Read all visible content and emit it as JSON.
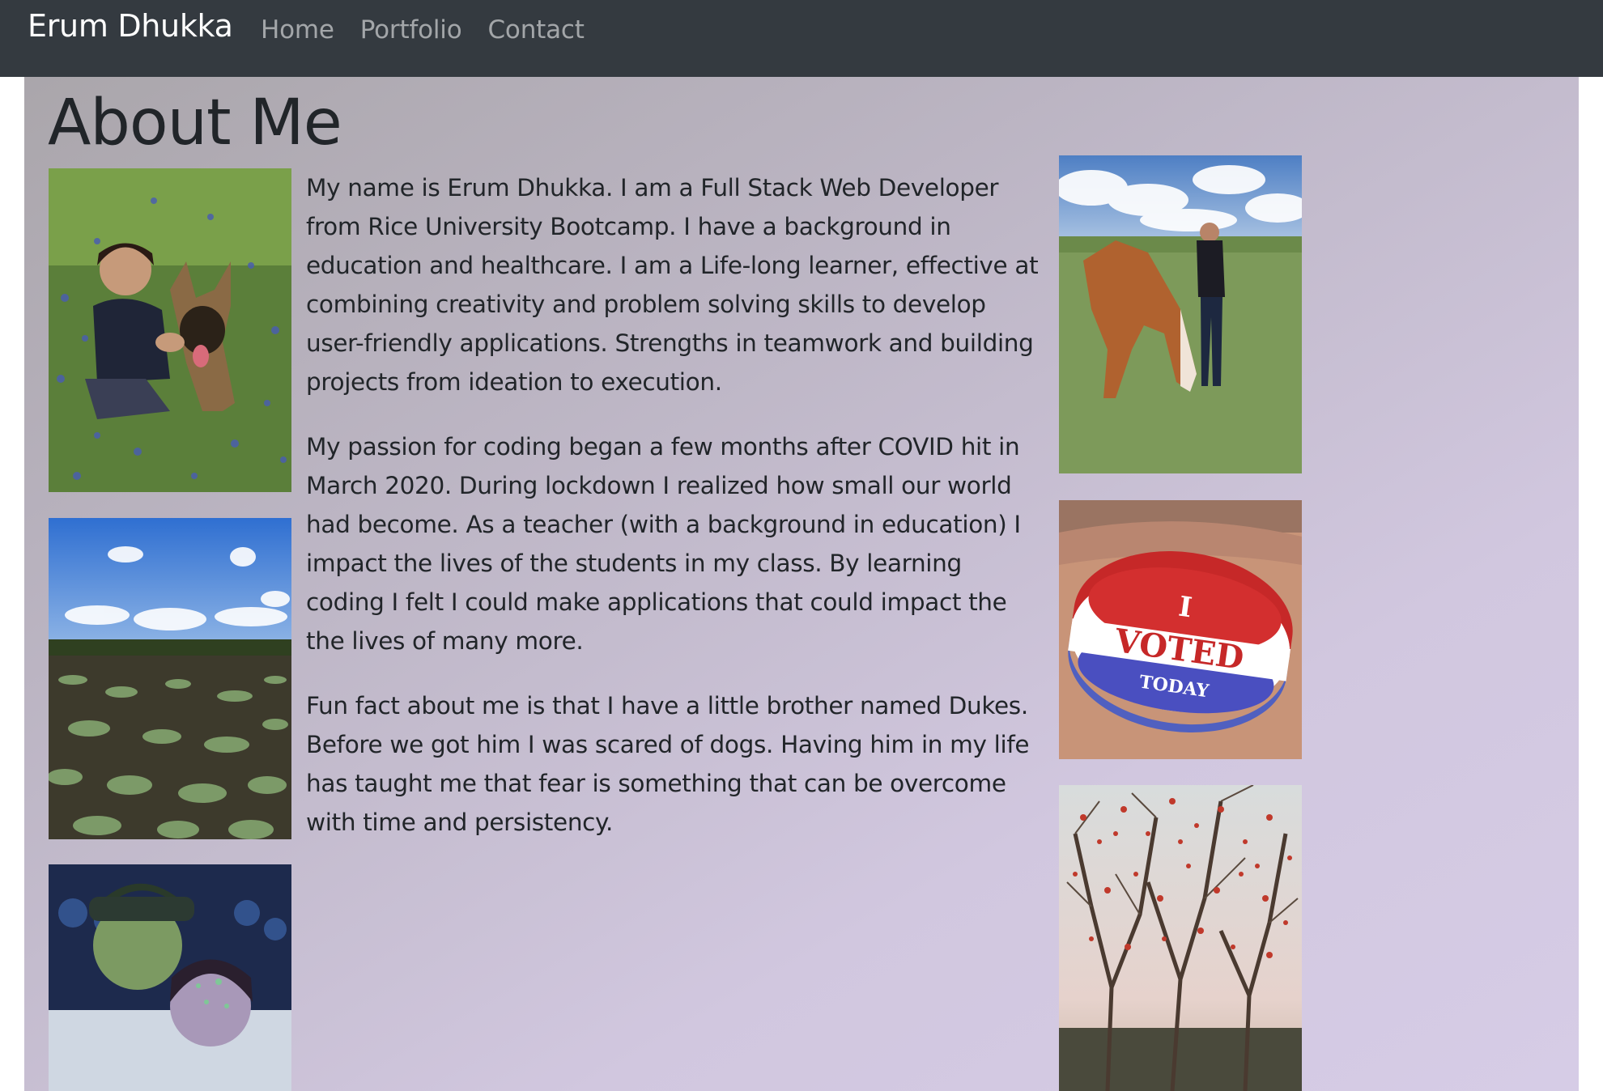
{
  "navbar": {
    "brand": "Erum Dhukka",
    "links": [
      "Home",
      "Portfolio",
      "Contact"
    ]
  },
  "main": {
    "title": "About Me",
    "paragraphs": [
      "My name is Erum Dhukka. I am a Full Stack Web Developer from Rice University Bootcamp. I have a background in education and healthcare. I am a Life-long learner, effective at combining creativity and problem solving skills to develop user-friendly applications. Strengths in teamwork and building projects from ideation to execution.",
      "My passion for coding began a few months after COVID hit in March 2020. During lockdown I realized how small our world had become. As a teacher (with a background in education) I impact the lives of the students in my class. By learning coding I felt I could make applications that could impact the the lives of many more.",
      "Fun fact about me is that I have a little brother named Dukes. Before we got him I was scared of dogs. Having him in my life has taught me that fear is something that can be overcome with time and persistency."
    ],
    "sticker_text": {
      "line1": "I",
      "line2": "VOTED",
      "line3": "TODAY"
    }
  },
  "colors": {
    "navbar_bg": "#343a40",
    "nav_link": "rgba(255,255,255,0.55)",
    "text": "#212529"
  }
}
